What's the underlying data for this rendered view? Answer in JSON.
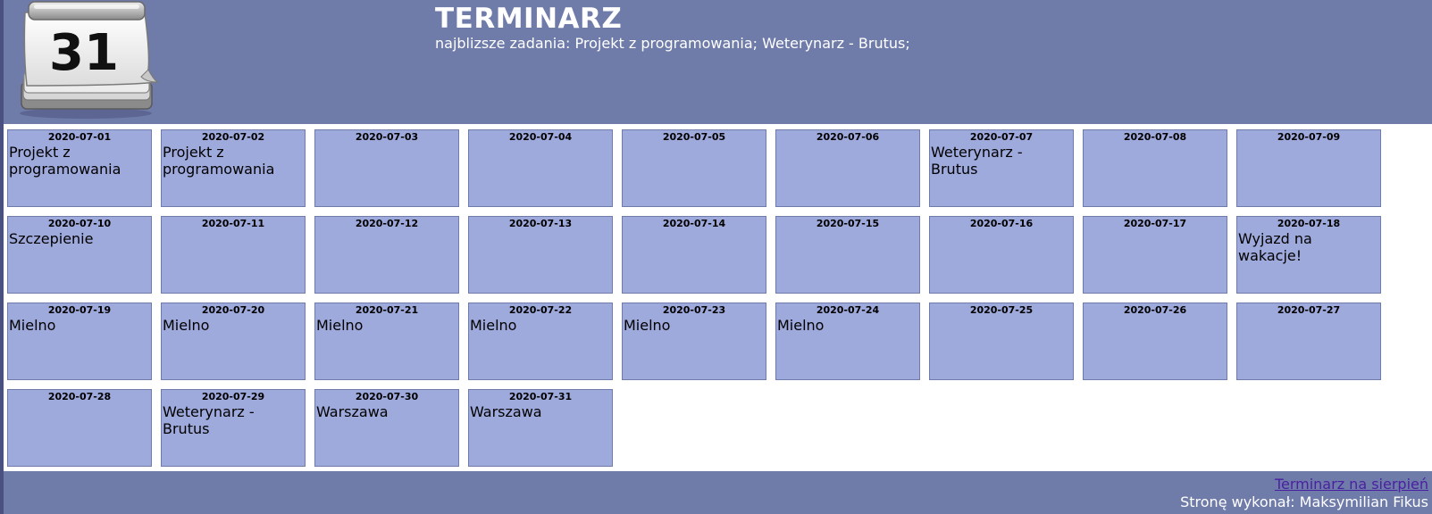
{
  "header": {
    "logo_day": "31",
    "title": "TERMINARZ",
    "upcoming": "najblizsze zadania: Projekt z programowania; Weterynarz - Brutus;"
  },
  "days": [
    {
      "date": "2020-07-01",
      "task": "Projekt z programowania"
    },
    {
      "date": "2020-07-02",
      "task": "Projekt z programowania"
    },
    {
      "date": "2020-07-03",
      "task": ""
    },
    {
      "date": "2020-07-04",
      "task": ""
    },
    {
      "date": "2020-07-05",
      "task": ""
    },
    {
      "date": "2020-07-06",
      "task": ""
    },
    {
      "date": "2020-07-07",
      "task": "Weterynarz - Brutus"
    },
    {
      "date": "2020-07-08",
      "task": ""
    },
    {
      "date": "2020-07-09",
      "task": ""
    },
    {
      "date": "2020-07-10",
      "task": "Szczepienie"
    },
    {
      "date": "2020-07-11",
      "task": ""
    },
    {
      "date": "2020-07-12",
      "task": ""
    },
    {
      "date": "2020-07-13",
      "task": ""
    },
    {
      "date": "2020-07-14",
      "task": ""
    },
    {
      "date": "2020-07-15",
      "task": ""
    },
    {
      "date": "2020-07-16",
      "task": ""
    },
    {
      "date": "2020-07-17",
      "task": ""
    },
    {
      "date": "2020-07-18",
      "task": "Wyjazd na wakacje!"
    },
    {
      "date": "2020-07-19",
      "task": "Mielno"
    },
    {
      "date": "2020-07-20",
      "task": "Mielno"
    },
    {
      "date": "2020-07-21",
      "task": "Mielno"
    },
    {
      "date": "2020-07-22",
      "task": "Mielno"
    },
    {
      "date": "2020-07-23",
      "task": "Mielno"
    },
    {
      "date": "2020-07-24",
      "task": "Mielno"
    },
    {
      "date": "2020-07-25",
      "task": ""
    },
    {
      "date": "2020-07-26",
      "task": ""
    },
    {
      "date": "2020-07-27",
      "task": ""
    },
    {
      "date": "2020-07-28",
      "task": ""
    },
    {
      "date": "2020-07-29",
      "task": "Weterynarz - Brutus"
    },
    {
      "date": "2020-07-30",
      "task": "Warszawa"
    },
    {
      "date": "2020-07-31",
      "task": "Warszawa"
    }
  ],
  "footer": {
    "next_month_link": "Terminarz na sierpień",
    "credit": "Stronę wykonał: Maksymilian Fikus"
  },
  "colors": {
    "header_bg": "#6f7ba9",
    "day_bg": "#9ea9dc",
    "day_border": "#6f7ba9",
    "link": "#4b1fa1"
  }
}
